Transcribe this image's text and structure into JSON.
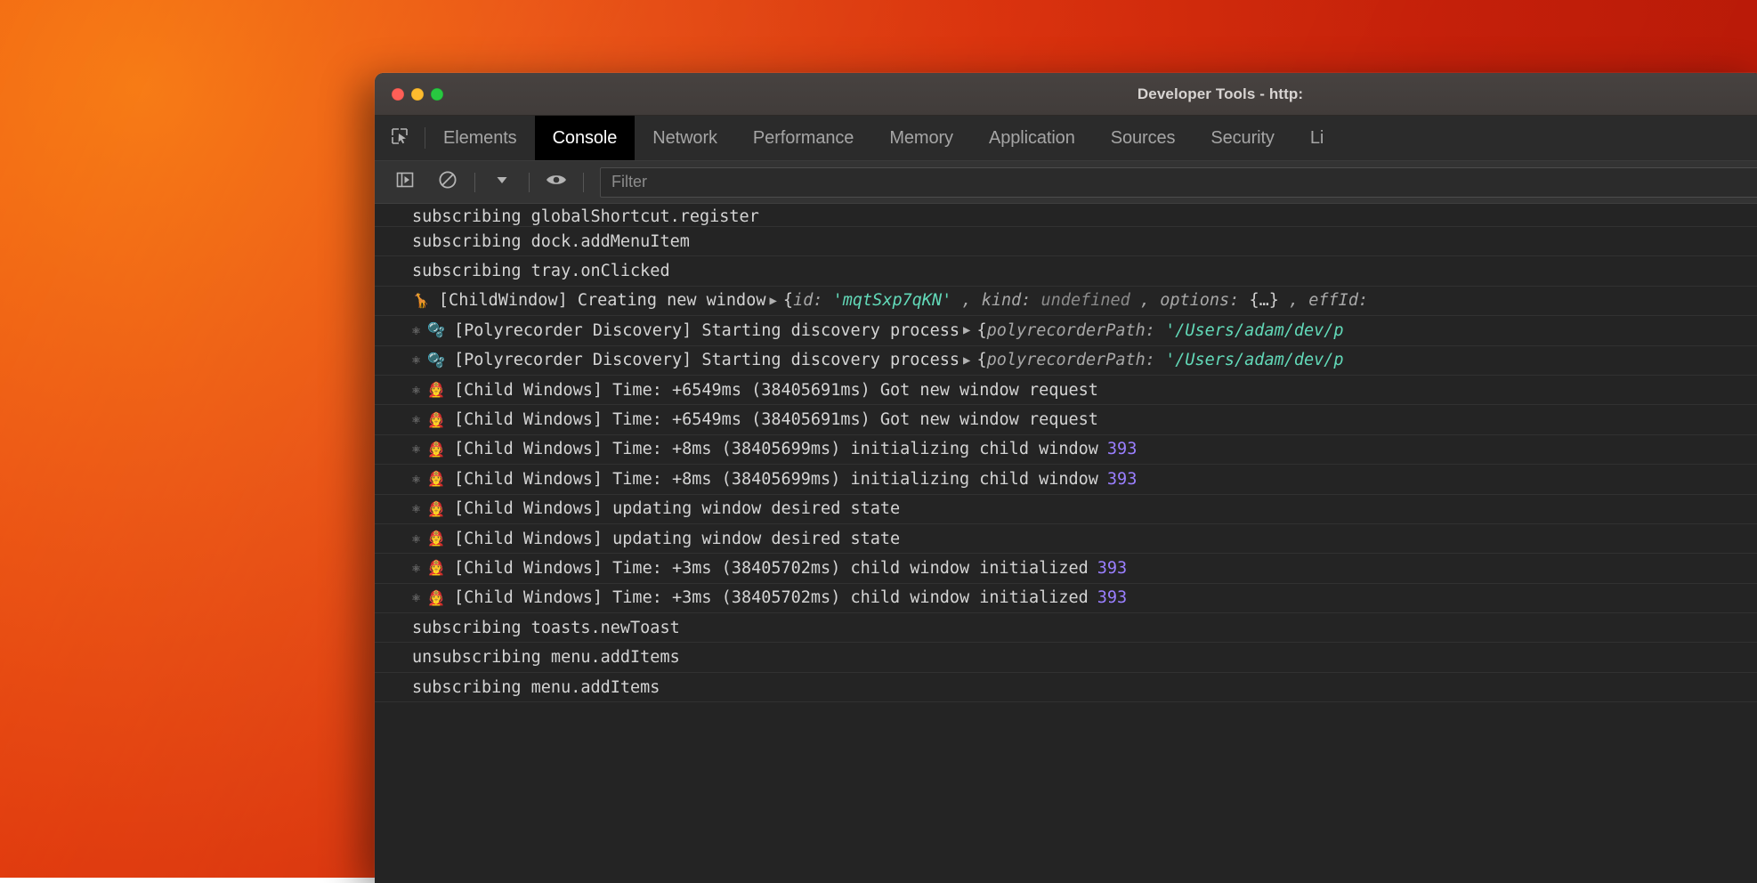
{
  "window": {
    "title": "Developer Tools - http:",
    "traffic_lights": [
      {
        "name": "close",
        "color": "#ff5f57"
      },
      {
        "name": "minimize",
        "color": "#febc2e"
      },
      {
        "name": "maximize",
        "color": "#28c840"
      }
    ]
  },
  "tabs": [
    {
      "label": "Elements",
      "selected": false
    },
    {
      "label": "Console",
      "selected": true
    },
    {
      "label": "Network",
      "selected": false
    },
    {
      "label": "Performance",
      "selected": false
    },
    {
      "label": "Memory",
      "selected": false
    },
    {
      "label": "Application",
      "selected": false
    },
    {
      "label": "Sources",
      "selected": false
    },
    {
      "label": "Security",
      "selected": false
    },
    {
      "label": "Li",
      "selected": false
    }
  ],
  "toolbar": {
    "inspect_icon": "inspect-element-icon",
    "sidebar_icon": "console-sidebar-icon",
    "clear_icon": "clear-console-icon",
    "context_icon": "chevron-down-icon",
    "eye_icon": "live-expression-icon",
    "filter_placeholder": "Filter",
    "filter_value": ""
  },
  "console": {
    "lines": [
      {
        "badges": [],
        "text": "subscribing globalShortcut.register",
        "clipped_top": true
      },
      {
        "badges": [],
        "text": "subscribing dock.addMenuItem"
      },
      {
        "badges": [],
        "text": "subscribing tray.onClicked"
      },
      {
        "badges": [
          "🦒"
        ],
        "text": "[ChildWindow] Creating new window",
        "expandable": true,
        "object": {
          "open": "{",
          "parts": [
            {
              "type": "key",
              "text": "id:"
            },
            {
              "type": "str",
              "text": "'mqtSxp7qKN'"
            },
            {
              "type": "key",
              "text": ", kind:"
            },
            {
              "type": "undef",
              "text": "undefined"
            },
            {
              "type": "key",
              "text": ", options:"
            },
            {
              "type": "brace",
              "text": "{…}"
            },
            {
              "type": "key",
              "text": ", effId:"
            }
          ]
        }
      },
      {
        "badges": [
          "⚛",
          "🫧"
        ],
        "text": "[Polyrecorder Discovery] Starting discovery process",
        "expandable": true,
        "object": {
          "open": "{",
          "parts": [
            {
              "type": "key",
              "text": "polyrecorderPath:"
            },
            {
              "type": "str",
              "text": "'/Users/adam/dev/p"
            }
          ]
        }
      },
      {
        "badges": [
          "⚛",
          "🫧"
        ],
        "text": "[Polyrecorder Discovery] Starting discovery process",
        "expandable": true,
        "object": {
          "open": "{",
          "parts": [
            {
              "type": "key",
              "text": "polyrecorderPath:"
            },
            {
              "type": "str",
              "text": "'/Users/adam/dev/p"
            }
          ]
        }
      },
      {
        "badges": [
          "⚛",
          "🧑‍🚒"
        ],
        "text": "[Child Windows] Time: +6549ms (38405691ms) Got new window request"
      },
      {
        "badges": [
          "⚛",
          "🧑‍🚒"
        ],
        "text": "[Child Windows] Time: +6549ms (38405691ms) Got new window request"
      },
      {
        "badges": [
          "⚛",
          "🧑‍🚒"
        ],
        "text": "[Child Windows] Time: +8ms (38405699ms) initializing child window",
        "number": "393"
      },
      {
        "badges": [
          "⚛",
          "🧑‍🚒"
        ],
        "text": "[Child Windows] Time: +8ms (38405699ms) initializing child window",
        "number": "393"
      },
      {
        "badges": [
          "⚛",
          "🧑‍🚒"
        ],
        "text": "[Child Windows] updating window desired state"
      },
      {
        "badges": [
          "⚛",
          "🧑‍🚒"
        ],
        "text": "[Child Windows] updating window desired state"
      },
      {
        "badges": [
          "⚛",
          "🧑‍🚒"
        ],
        "text": "[Child Windows] Time: +3ms (38405702ms) child window initialized",
        "number": "393"
      },
      {
        "badges": [
          "⚛",
          "🧑‍🚒"
        ],
        "text": "[Child Windows] Time: +3ms (38405702ms) child window initialized",
        "number": "393"
      },
      {
        "badges": [],
        "text": "subscribing toasts.newToast"
      },
      {
        "badges": [],
        "text": "unsubscribing menu.addItems"
      },
      {
        "badges": [],
        "text": "subscribing menu.addItems"
      }
    ]
  },
  "colors": {
    "accent_number": "#9a7fff",
    "string_value": "#62d9b8",
    "console_bg": "#242424",
    "toolbar_bg": "#333333",
    "tabstrip_bg": "#2b2b2b",
    "titlebar_bg": "#474240",
    "selected_tab_bg": "#000000",
    "desktop_bg": "#d8350f"
  }
}
